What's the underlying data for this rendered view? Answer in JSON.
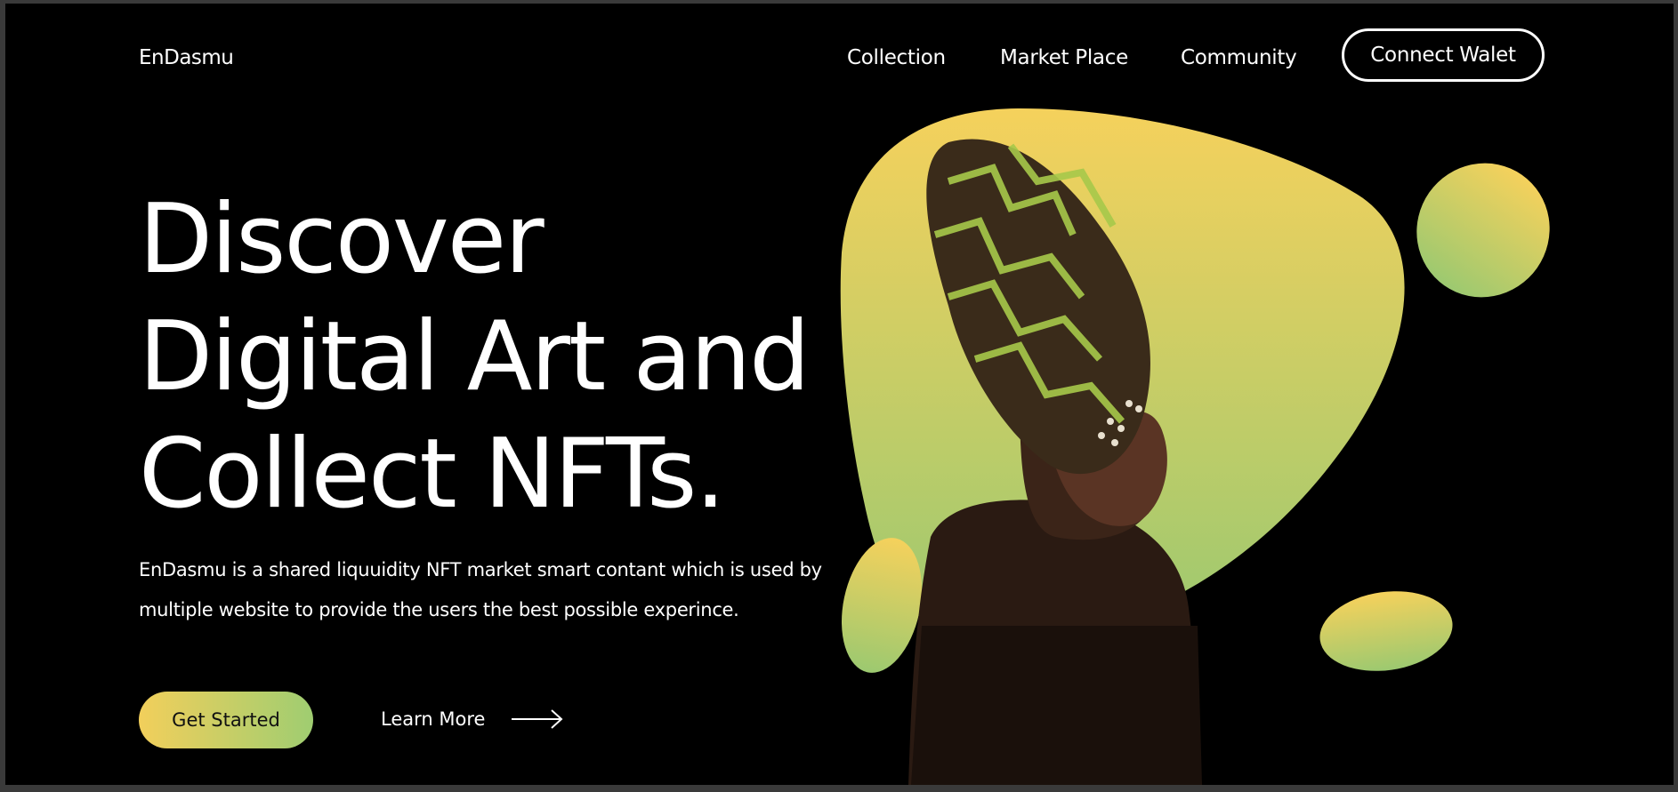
{
  "brand": {
    "name": "EnDasmu"
  },
  "nav": {
    "items": [
      {
        "label": "Collection"
      },
      {
        "label": "Market Place"
      },
      {
        "label": "Community"
      }
    ],
    "connect_label": "Connect Walet"
  },
  "hero": {
    "headline_lines": [
      "Discover",
      "Digital Art and",
      "Collect NFTs."
    ],
    "description": "EnDasmu is a shared liquuidity NFT market smart contant which is used by multiple website to provide the users the best possible experince.",
    "primary_cta": "Get Started",
    "secondary_cta": "Learn More"
  },
  "colors": {
    "background": "#000000",
    "text": "#ffffff",
    "gradient_yellow": "#f2cf5b",
    "gradient_green": "#9fcd71"
  },
  "icons": {
    "learn_more": "arrow-right-icon"
  }
}
